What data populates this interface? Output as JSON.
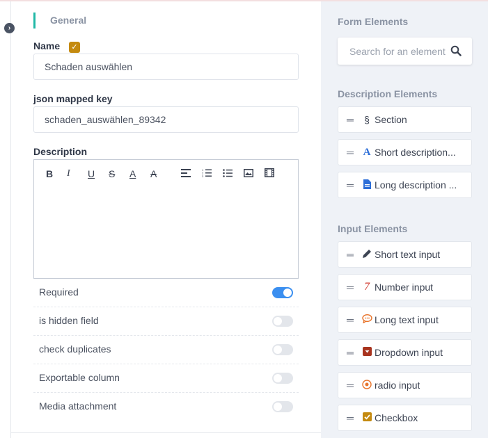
{
  "editor": {
    "section_title": "General",
    "name": {
      "label": "Name",
      "value": "Schaden auswählen"
    },
    "json_key": {
      "label": "json mapped key",
      "value": "schaden_auswählen_89342"
    },
    "description": {
      "label": "Description",
      "toolbar": {
        "bold": "B",
        "italic": "I",
        "underline": "U",
        "strike": "S",
        "font_color": "A",
        "bg_color": "A"
      }
    },
    "toggles": [
      {
        "label": "Required",
        "on": true
      },
      {
        "label": "is hidden field",
        "on": false
      },
      {
        "label": "check duplicates",
        "on": false
      },
      {
        "label": "Exportable column",
        "on": false
      },
      {
        "label": "Media attachment",
        "on": false
      }
    ]
  },
  "palette": {
    "form_heading": "Form Elements",
    "search_placeholder": "Search for an element",
    "description_heading": "Description Elements",
    "description_items": [
      {
        "label": "Section",
        "icon": "section-sign-icon",
        "glyph": "§"
      },
      {
        "label": "Short description...",
        "icon": "font-a-icon",
        "glyph": "A"
      },
      {
        "label": "Long description ...",
        "icon": "document-icon",
        "glyph": ""
      }
    ],
    "input_heading": "Input Elements",
    "input_items": [
      {
        "label": "Short text input",
        "icon": "pencil-icon",
        "glyph": ""
      },
      {
        "label": "Number input",
        "icon": "number-seven-icon",
        "glyph": "7"
      },
      {
        "label": "Long text input",
        "icon": "speech-bubble-icon",
        "glyph": ""
      },
      {
        "label": "Dropdown input",
        "icon": "dropdown-box-icon",
        "glyph": ""
      },
      {
        "label": "radio input",
        "icon": "radio-dot-icon",
        "glyph": ""
      },
      {
        "label": "Checkbox",
        "icon": "checkbox-icon",
        "glyph": ""
      }
    ]
  },
  "colors": {
    "accent_teal": "#20b8a6",
    "toggle_on": "#3b8ff0",
    "checkbox_gold": "#c48a10",
    "palette_bg": "#eff2f7"
  }
}
